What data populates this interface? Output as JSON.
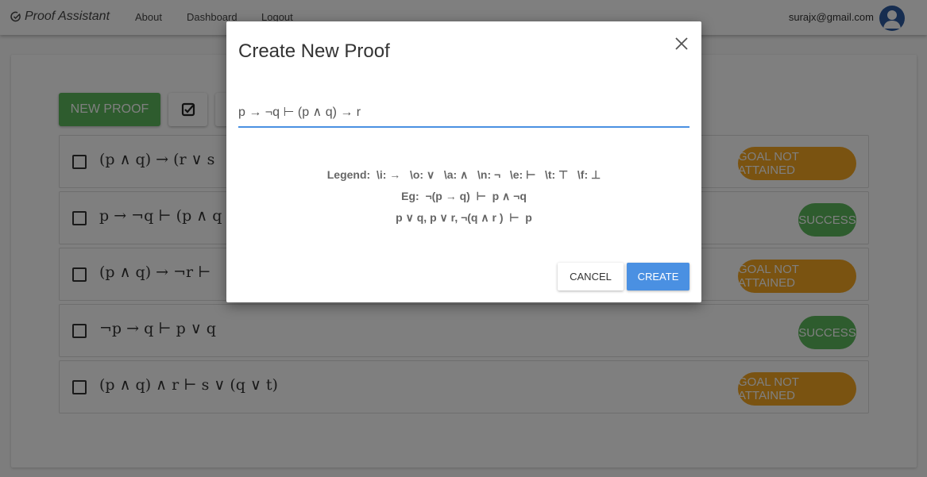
{
  "navbar": {
    "brand": "Proof Assistant",
    "links": [
      "About",
      "Dashboard",
      "Logout"
    ],
    "user_email": "surajx@gmail.com"
  },
  "toolbar": {
    "new_proof_label": "NEW PROOF"
  },
  "proofs": [
    {
      "formula": "(p ∧ q) → (r ∨ s",
      "status": "GOAL NOT ATTAINED",
      "ok": false
    },
    {
      "formula": "p → ¬q ⊢ (p ∧ q",
      "status": "SUCCESS",
      "ok": true
    },
    {
      "formula": "(p ∧ q) → ¬r ⊢",
      "status": "GOAL NOT ATTAINED",
      "ok": false
    },
    {
      "formula": "¬p → q ⊢ p ∨ q",
      "status": "SUCCESS",
      "ok": true
    },
    {
      "formula": "(p ∧ q) ∧ r ⊢ s ∨ (q ∨ t)",
      "status": "GOAL NOT ATTAINED",
      "ok": false
    }
  ],
  "modal": {
    "title": "Create New Proof",
    "input_value": "p → ¬q ⊢ (p ∧ q) → r",
    "legend_line1": "Legend:  \\i: →   \\o: ∨   \\a: ∧   \\n: ¬   \\e: ⊢   \\t: ⊤   \\f: ⊥",
    "legend_line2": "Eg:  ¬(p → q)  ⊢  p ∧ ¬q",
    "legend_line3": "p ∨ q, p ∨ r, ¬(q ∧ r )  ⊢  p",
    "cancel_label": "CANCEL",
    "create_label": "CREATE"
  },
  "colors": {
    "primary": "#4a90e2",
    "success": "#5cb85c",
    "warning": "#f5a623"
  }
}
